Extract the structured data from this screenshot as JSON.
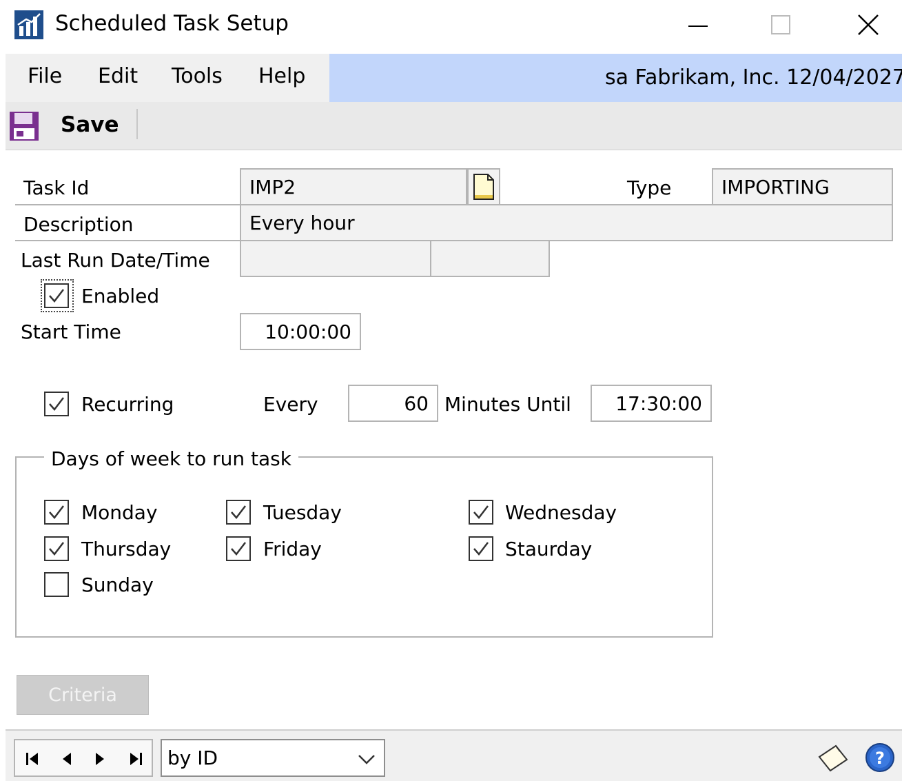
{
  "window": {
    "title": "Scheduled Task Setup",
    "controls": {
      "minimize": "minimize-icon",
      "maximize": "maximize-icon",
      "close": "close-icon"
    }
  },
  "menu": {
    "items": [
      {
        "label": "File"
      },
      {
        "label": "Edit"
      },
      {
        "label": "Tools"
      },
      {
        "label": "Help"
      }
    ],
    "status": "sa  Fabrikam, Inc.  12/04/2027"
  },
  "toolbar": {
    "save_label": "Save"
  },
  "form": {
    "task_id_label": "Task Id",
    "task_id_value": "IMP2",
    "type_label": "Type",
    "type_value": "IMPORTING",
    "description_label": "Description",
    "description_value": "Every hour",
    "last_run_label": "Last Run Date/Time",
    "last_run_date": "",
    "last_run_time": "",
    "enabled_label": "Enabled",
    "enabled_checked": true,
    "start_time_label": "Start Time",
    "start_time_value": "10:00:00",
    "recurring_label": "Recurring",
    "recurring_checked": true,
    "every_label": "Every",
    "every_value": "60",
    "minutes_until_label": "Minutes Until",
    "until_value": "17:30:00"
  },
  "days": {
    "legend": "Days of week to run task",
    "items": [
      {
        "label": "Monday",
        "checked": true
      },
      {
        "label": "Tuesday",
        "checked": true
      },
      {
        "label": "Wednesday",
        "checked": true
      },
      {
        "label": "Thursday",
        "checked": true
      },
      {
        "label": "Friday",
        "checked": true
      },
      {
        "label": "Staurday",
        "checked": true
      },
      {
        "label": "Sunday",
        "checked": false
      }
    ]
  },
  "criteria_label": "Criteria",
  "bottom": {
    "sort_value": "by ID"
  },
  "colors": {
    "menu_highlight": "#c2d6fb",
    "toolbar_bg": "#e9e9e9",
    "disabled_button": "#cdcdcd"
  }
}
